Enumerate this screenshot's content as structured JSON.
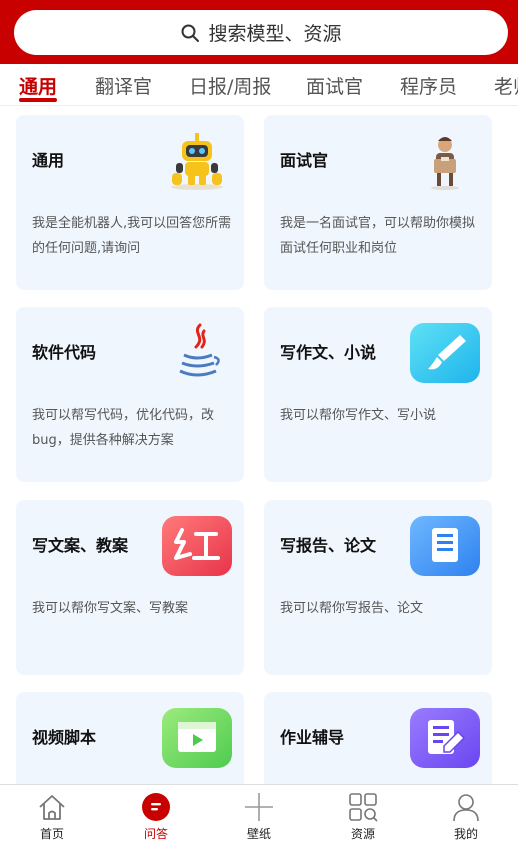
{
  "search": {
    "placeholder": "搜索模型、资源"
  },
  "tabs": [
    "通用",
    "翻译官",
    "日报/周报",
    "面试官",
    "程序员",
    "老师"
  ],
  "active_tab": "通用",
  "cards": [
    {
      "title": "通用",
      "desc": "我是全能机器人,我可以回答您所需的任何问题,请询问",
      "icon": "robot-icon"
    },
    {
      "title": "面试官",
      "desc": "我是一名面试官，可以帮助你模拟面试任何职业和岗位",
      "icon": "interviewer-icon"
    },
    {
      "title": "软件代码",
      "desc": "我可以帮写代码，优化代码，改bug，提供各种解决方案",
      "icon": "java-coffee-icon"
    },
    {
      "title": "写作文、小说",
      "desc": "我可以帮你写作文、写小说",
      "icon": "brush-icon"
    },
    {
      "title": "写文案、教案",
      "desc": "我可以帮你写文案、写教案",
      "icon": "red-copy-icon"
    },
    {
      "title": "写报告、论文",
      "desc": "我可以帮你写报告、论文",
      "icon": "document-icon"
    },
    {
      "title": "视频脚本",
      "desc": "",
      "icon": "video-clapper-icon"
    },
    {
      "title": "作业辅导",
      "desc": "",
      "icon": "homework-edit-icon"
    }
  ],
  "bottom_nav": [
    {
      "label": "首页",
      "icon": "home-icon"
    },
    {
      "label": "问答",
      "icon": "chat-icon"
    },
    {
      "label": "壁纸",
      "icon": "plus-icon"
    },
    {
      "label": "资源",
      "icon": "grid-search-icon"
    },
    {
      "label": "我的",
      "icon": "user-icon"
    }
  ],
  "active_nav": "问答",
  "colors": {
    "primary": "#c80000",
    "card_bg": "#f0f6fe"
  }
}
